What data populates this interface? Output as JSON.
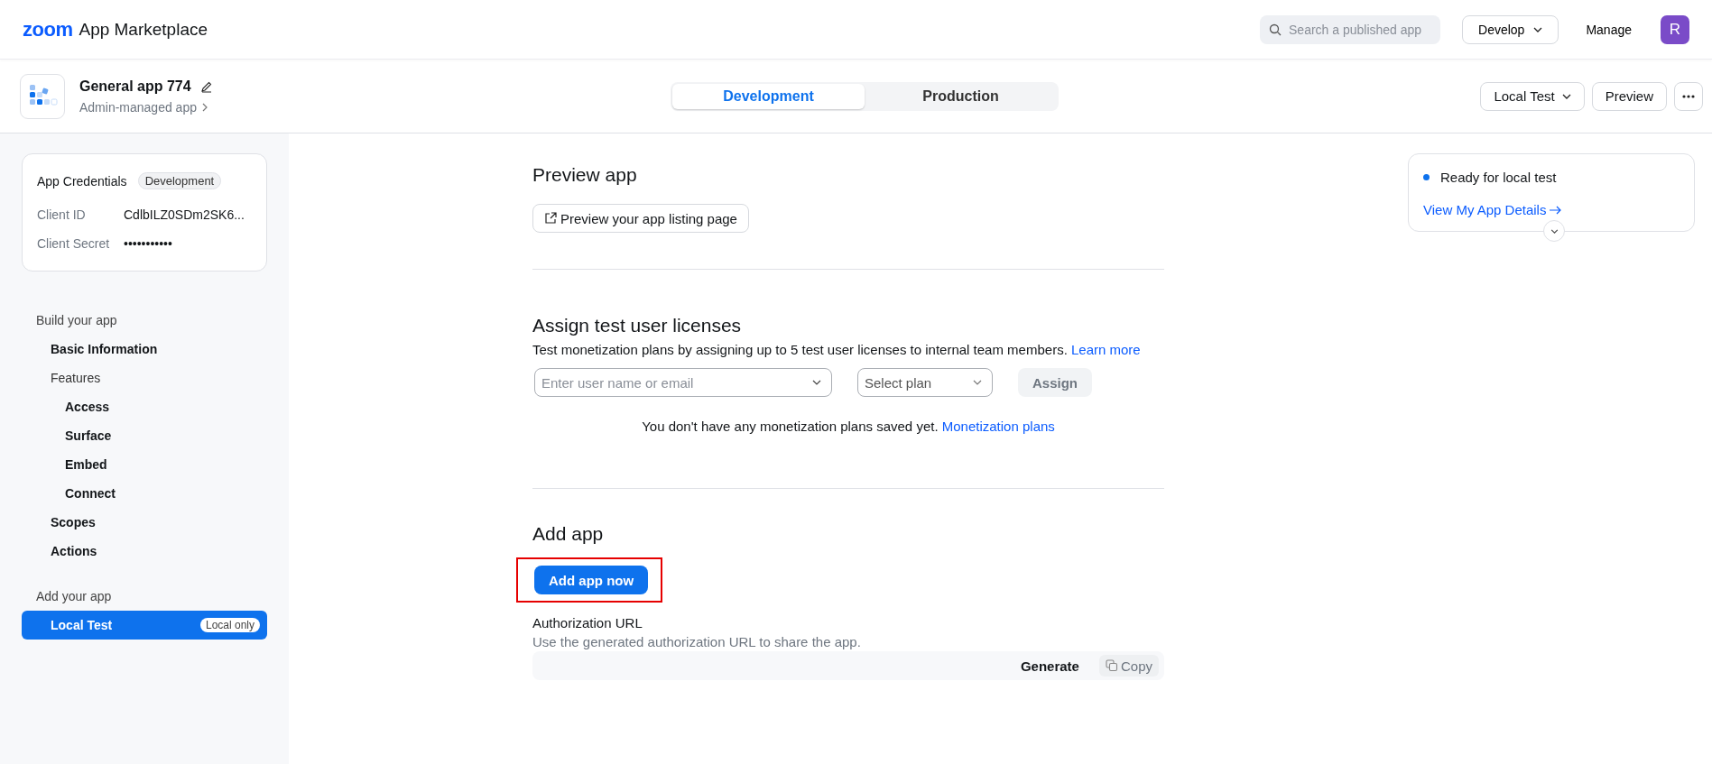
{
  "header": {
    "logo": "zoom",
    "title": "App Marketplace",
    "search": {
      "placeholder": "Search a published app"
    },
    "develop": "Develop",
    "manage": "Manage",
    "avatar": "R"
  },
  "app": {
    "name": "General app 774",
    "type": "Admin-managed app"
  },
  "tabs": [
    {
      "label": "Development",
      "selected": true
    },
    {
      "label": "Production",
      "selected": false
    }
  ],
  "actions": {
    "local_test": "Local Test",
    "preview": "Preview"
  },
  "credentials": {
    "title": "App Credentials",
    "badge": "Development",
    "rows": [
      {
        "label": "Client ID",
        "value": "CdlbILZ0SDm2SK6..."
      },
      {
        "label": "Client Secret",
        "value": "•••••••••••"
      }
    ]
  },
  "nav": [
    {
      "heading": "Build your app",
      "items": [
        {
          "label": "Basic Information",
          "selected": false
        },
        {
          "label": "Features",
          "selected": false,
          "children": [
            {
              "label": "Access",
              "selected": false
            },
            {
              "label": "Surface",
              "selected": false
            },
            {
              "label": "Embed",
              "selected": false
            },
            {
              "label": "Connect",
              "selected": false
            }
          ]
        },
        {
          "label": "Scopes",
          "selected": false
        },
        {
          "label": "Actions",
          "selected": false
        }
      ]
    },
    {
      "heading": "Add your app",
      "items": [
        {
          "label": "Local Test",
          "selected": true,
          "badge": "Local only"
        }
      ]
    }
  ],
  "preview": {
    "title": "Preview app",
    "button": "Preview your app listing page"
  },
  "licenses": {
    "title": "Assign test user licenses",
    "description": "Test monetization plans by assigning up to 5 test user licenses to internal team members.",
    "link": "Learn more",
    "user_placeholder": "Enter user name or email",
    "plan_placeholder": "Select plan",
    "assign": "Assign",
    "assign_disabled": true,
    "empty": "You don't have any monetization plans saved yet.",
    "empty_link": "Monetization plans"
  },
  "add_app": {
    "title": "Add app",
    "button": "Add app now",
    "highlighted": true,
    "auth_title": "Authorization URL",
    "auth_description": "Use the generated authorization URL to share the app.",
    "generate": "Generate",
    "copy": "Copy"
  },
  "status": {
    "text": "Ready for local test",
    "color": "#0e72ed",
    "link": "View My App Details"
  }
}
